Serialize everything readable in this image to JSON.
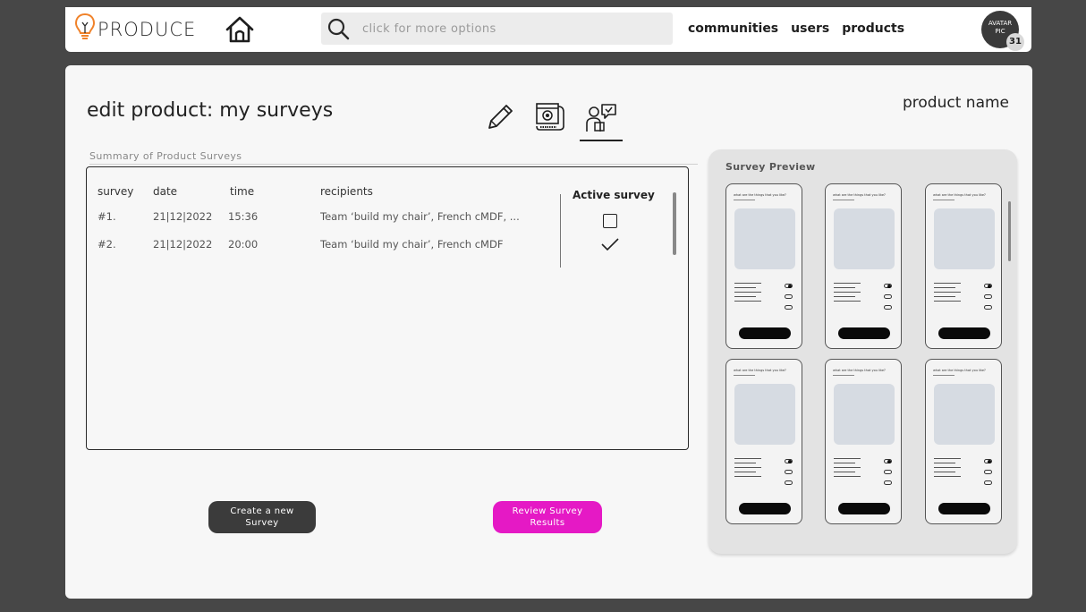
{
  "header": {
    "logo_text": "PRODUCE",
    "search_placeholder": "click for more options",
    "nav": [
      "communities",
      "users",
      "products"
    ],
    "avatar_label_1": "AVATAR",
    "avatar_label_2": "PIC",
    "avatar_badge": "31"
  },
  "page": {
    "title": "edit product: my surveys",
    "product_name": "product name",
    "summary_label": "Summary of Product Surveys",
    "mode_tabs": [
      "edit-icon",
      "blueprint-icon",
      "survey-icon"
    ],
    "active_mode": "survey-icon"
  },
  "table": {
    "columns": {
      "survey": "survey",
      "date": "date",
      "time": "time",
      "recipients": "recipients",
      "active": "Active survey"
    },
    "rows": [
      {
        "survey": "#1.",
        "date": "21|12|2022",
        "time": "15:36",
        "recipients": "Team ‘build my chair’, French cMDF, ...",
        "active": false
      },
      {
        "survey": "#2.",
        "date": "21|12|2022",
        "time": "20:00",
        "recipients": "Team ‘build my chair’, French cMDF",
        "active": true
      }
    ]
  },
  "buttons": {
    "create_line1": "Create a new",
    "create_line2": "Survey",
    "review_line1": "Review Survey",
    "review_line2": "Results"
  },
  "preview": {
    "title": "Survey Preview",
    "question": "what are the things that you like?",
    "count": 6
  },
  "colors": {
    "background": "#474747",
    "card": "#f7f7f7",
    "accent_pink": "#e519c5",
    "button_dark": "#3b3b3b",
    "logo_bulb": "#f0822a"
  }
}
